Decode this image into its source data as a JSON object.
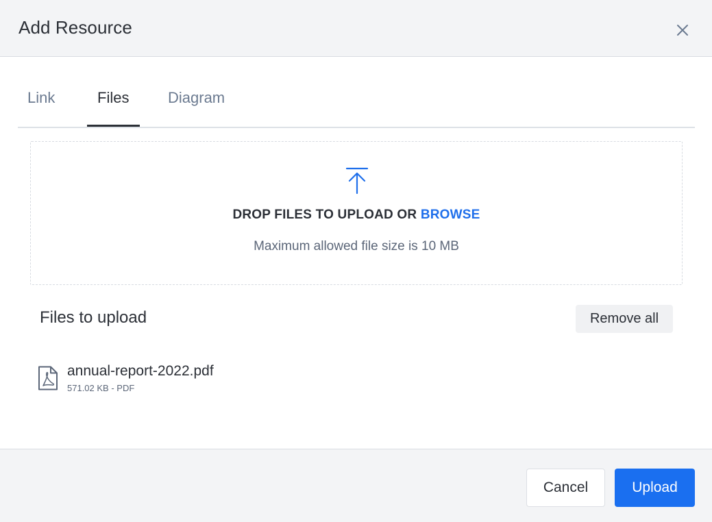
{
  "dialog": {
    "title": "Add Resource",
    "close_icon": "close-icon"
  },
  "tabs": [
    {
      "label": "Link",
      "active": false
    },
    {
      "label": "Files",
      "active": true
    },
    {
      "label": "Diagram",
      "active": false
    }
  ],
  "dropzone": {
    "icon": "upload-arrow-icon",
    "text": "DROP FILES TO UPLOAD OR ",
    "browse_label": "BROWSE",
    "max_size_text": "Maximum allowed file size is 10 MB"
  },
  "files_section": {
    "heading": "Files to upload",
    "remove_all_label": "Remove all",
    "files": [
      {
        "icon": "pdf-file-icon",
        "name": "annual-report-2022.pdf",
        "meta": "571.02 KB - PDF"
      }
    ]
  },
  "footer": {
    "cancel_label": "Cancel",
    "upload_label": "Upload"
  },
  "colors": {
    "accent": "#1a6ff0",
    "link": "#1f6feb",
    "text": "#2b2f36",
    "muted": "#5b6678",
    "header_bg": "#f3f4f6"
  }
}
